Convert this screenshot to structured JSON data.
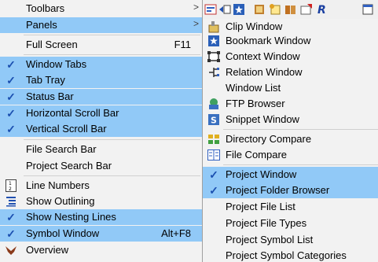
{
  "main_menu": {
    "items": [
      {
        "label": "Toolbars",
        "submenu": true
      },
      {
        "label": "Panels",
        "submenu": true,
        "highlighted": true
      },
      {
        "label": "Full Screen",
        "shortcut": "F11"
      },
      {
        "label": "Window Tabs",
        "checked": true
      },
      {
        "label": "Tab Tray",
        "checked": true
      },
      {
        "label": "Status Bar",
        "checked": true
      },
      {
        "label": "Horizontal Scroll Bar",
        "checked": true
      },
      {
        "label": "Vertical Scroll Bar",
        "checked": true
      },
      {
        "label": "File Search Bar"
      },
      {
        "label": "Project Search Bar"
      },
      {
        "label": "Line Numbers",
        "icon": "line-numbers-icon"
      },
      {
        "label": "Show Outlining",
        "icon": "outlining-icon"
      },
      {
        "label": "Show Nesting Lines",
        "checked": true
      },
      {
        "label": "Symbol Window",
        "checked": true,
        "shortcut": "Alt+F8"
      },
      {
        "label": "Overview",
        "icon": "overview-bird-icon"
      }
    ],
    "arrow_glyph": ">"
  },
  "sub_menu": {
    "items": [
      {
        "label": "Clip Window",
        "icon": "clip-window-icon"
      },
      {
        "label": "Bookmark Window",
        "icon": "bookmark-star-icon"
      },
      {
        "label": "Context Window",
        "icon": "context-window-icon"
      },
      {
        "label": "Relation Window",
        "icon": "relation-window-icon"
      },
      {
        "label": "Window List"
      },
      {
        "label": "FTP Browser",
        "icon": "ftp-browser-icon"
      },
      {
        "label": "Snippet Window",
        "icon": "snippet-window-icon"
      },
      {
        "label": "Directory Compare",
        "icon": "directory-compare-icon"
      },
      {
        "label": "File Compare",
        "icon": "file-compare-icon"
      },
      {
        "label": "Project Window",
        "checked": true,
        "highlighted": true
      },
      {
        "label": "Project Folder Browser",
        "checked": true
      },
      {
        "label": "Project File List"
      },
      {
        "label": "Project File Types"
      },
      {
        "label": "Project Symbol List"
      },
      {
        "label": "Project Symbol Categories"
      }
    ]
  },
  "colors": {
    "highlight": "#91c9f7",
    "check": "#1a4fb0",
    "menu_bg": "#f2f2f2"
  },
  "check_glyph": "✓"
}
